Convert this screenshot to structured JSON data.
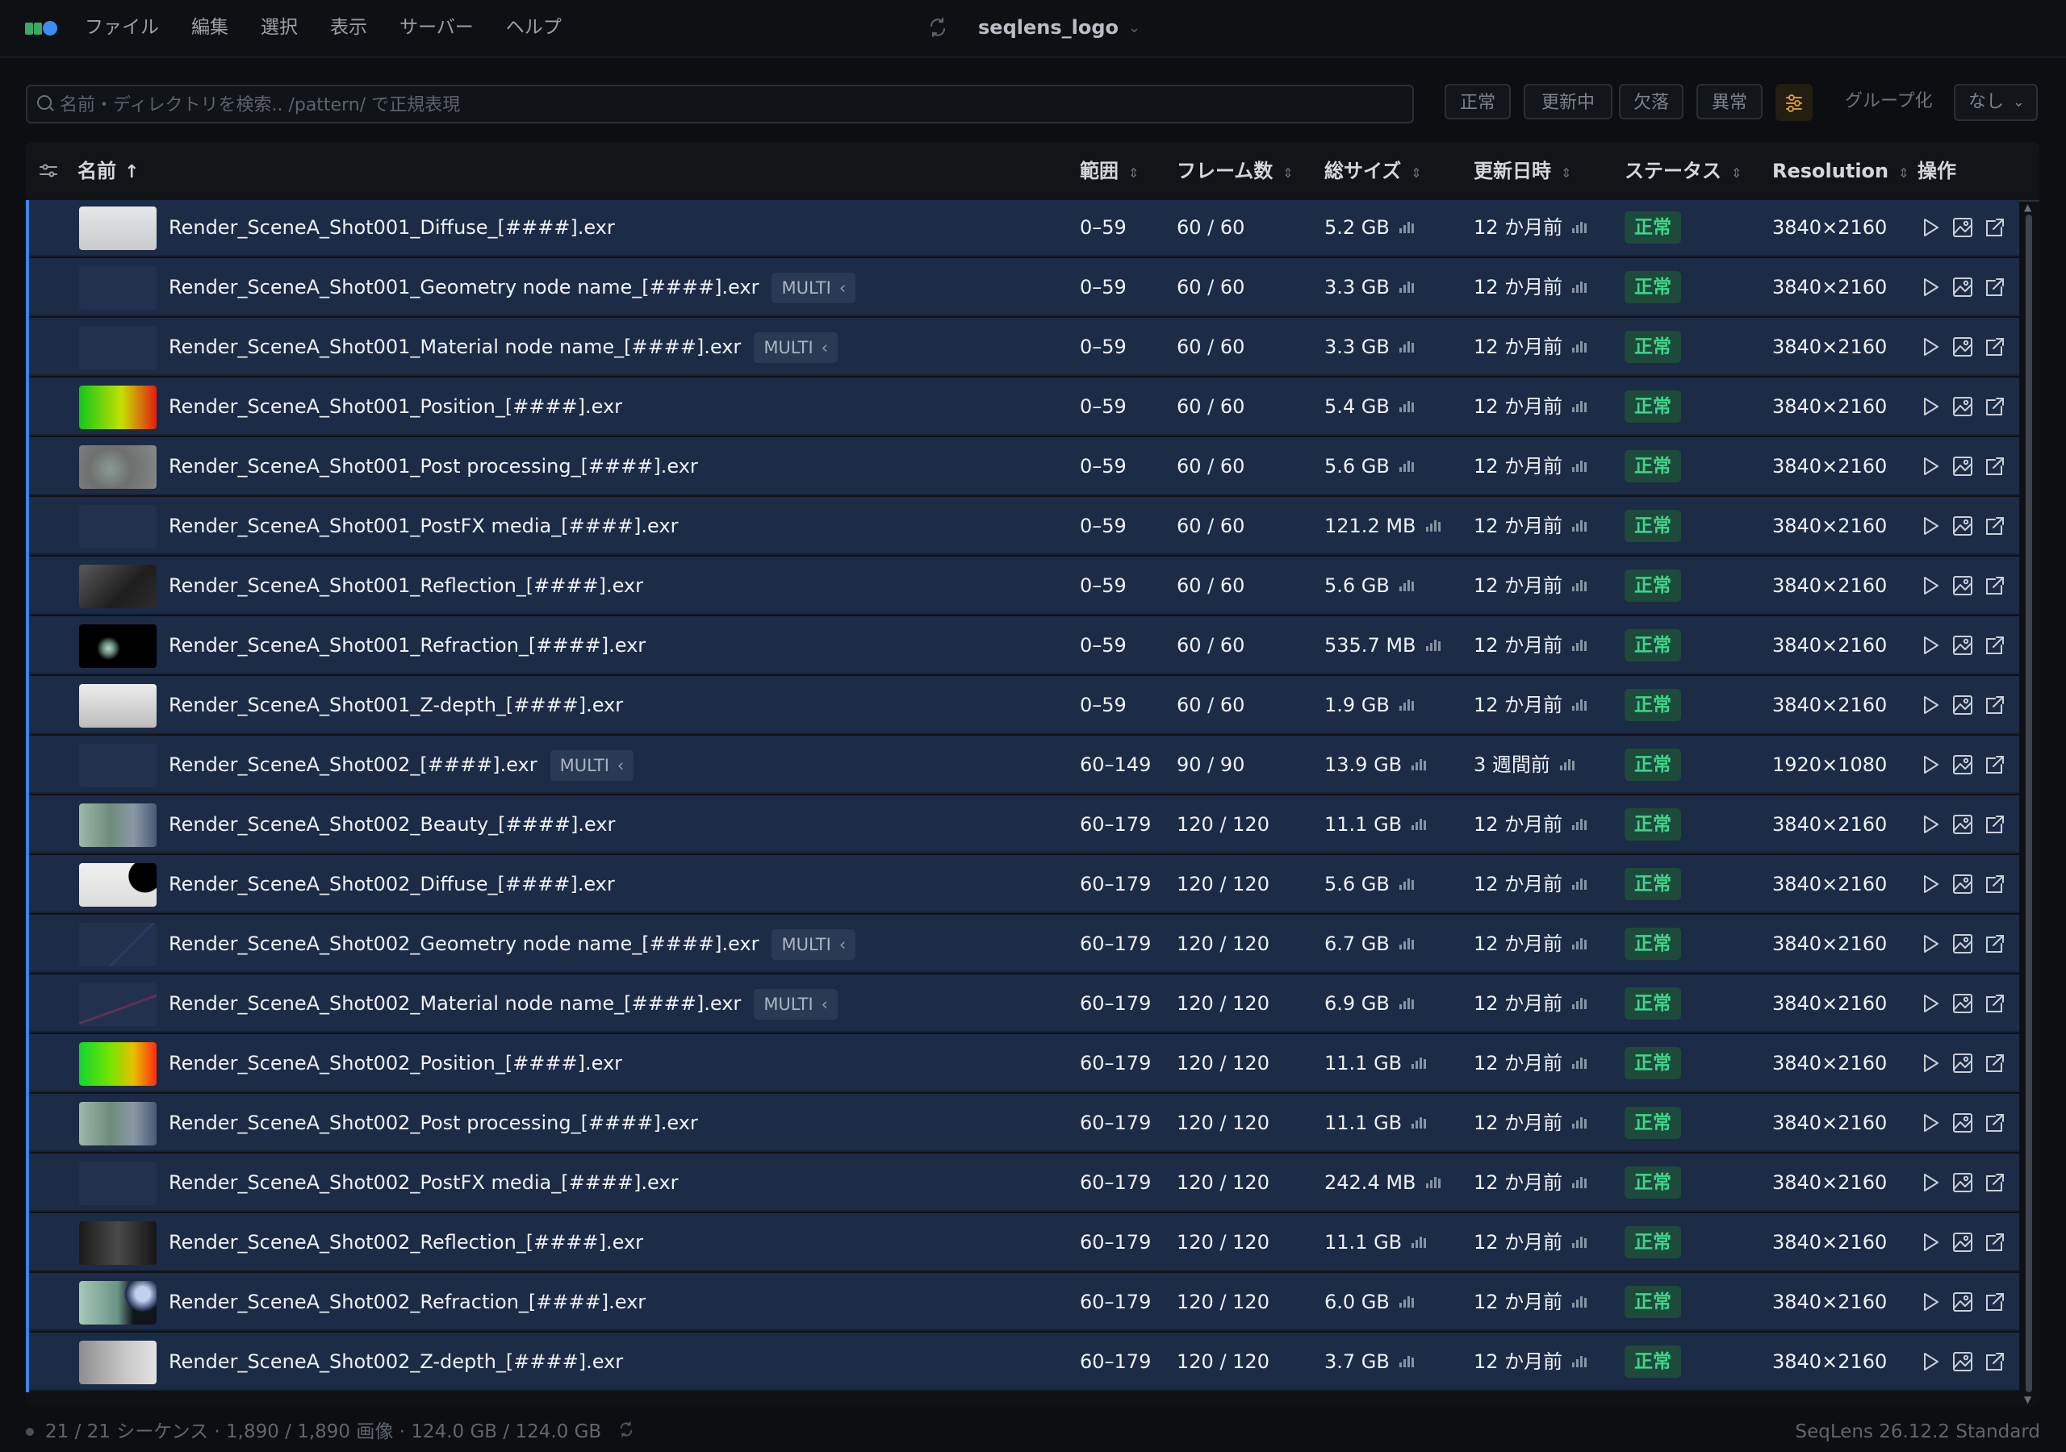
{
  "menu": [
    "ファイル",
    "編集",
    "選択",
    "表示",
    "サーバー",
    "ヘルプ"
  ],
  "window_title": "seqlens_logo",
  "search": {
    "placeholder": "名前・ディレクトリを検索.. /pattern/ で正規表現",
    "value": ""
  },
  "filters": [
    "正常",
    "更新中",
    "欠落",
    "異常"
  ],
  "group_label": "グループ化",
  "group_value": "なし",
  "columns": {
    "name": "名前",
    "range": "範囲",
    "frames": "フレーム数",
    "size": "総サイズ",
    "modified": "更新日時",
    "status": "ステータス",
    "resolution": "Resolution",
    "actions": "操作"
  },
  "rows": [
    {
      "name": "Render_SceneA_Shot001_Diffuse_[####].exr",
      "multi": "",
      "range": "0–59",
      "frames": "60 / 60",
      "size": "5.2 GB",
      "modified": "12 か月前",
      "status": "正常",
      "res": "3840×2160",
      "thumb": "diffuse1"
    },
    {
      "name": "Render_SceneA_Shot001_Geometry node name_[####].exr",
      "multi": "MULTI",
      "range": "0–59",
      "frames": "60 / 60",
      "size": "3.3 GB",
      "modified": "12 か月前",
      "status": "正常",
      "res": "3840×2160",
      "thumb": "blank"
    },
    {
      "name": "Render_SceneA_Shot001_Material node name_[####].exr",
      "multi": "MULTI",
      "range": "0–59",
      "frames": "60 / 60",
      "size": "3.3 GB",
      "modified": "12 か月前",
      "status": "正常",
      "res": "3840×2160",
      "thumb": "material1"
    },
    {
      "name": "Render_SceneA_Shot001_Position_[####].exr",
      "multi": "",
      "range": "0–59",
      "frames": "60 / 60",
      "size": "5.4 GB",
      "modified": "12 か月前",
      "status": "正常",
      "res": "3840×2160",
      "thumb": "position1"
    },
    {
      "name": "Render_SceneA_Shot001_Post processing_[####].exr",
      "multi": "",
      "range": "0–59",
      "frames": "60 / 60",
      "size": "5.6 GB",
      "modified": "12 か月前",
      "status": "正常",
      "res": "3840×2160",
      "thumb": "post1"
    },
    {
      "name": "Render_SceneA_Shot001_PostFX media_[####].exr",
      "multi": "",
      "range": "0–59",
      "frames": "60 / 60",
      "size": "121.2 MB",
      "modified": "12 か月前",
      "status": "正常",
      "res": "3840×2160",
      "thumb": "blank"
    },
    {
      "name": "Render_SceneA_Shot001_Reflection_[####].exr",
      "multi": "",
      "range": "0–59",
      "frames": "60 / 60",
      "size": "5.6 GB",
      "modified": "12 か月前",
      "status": "正常",
      "res": "3840×2160",
      "thumb": "reflect1"
    },
    {
      "name": "Render_SceneA_Shot001_Refraction_[####].exr",
      "multi": "",
      "range": "0–59",
      "frames": "60 / 60",
      "size": "535.7 MB",
      "modified": "12 か月前",
      "status": "正常",
      "res": "3840×2160",
      "thumb": "refract1"
    },
    {
      "name": "Render_SceneA_Shot001_Z-depth_[####].exr",
      "multi": "",
      "range": "0–59",
      "frames": "60 / 60",
      "size": "1.9 GB",
      "modified": "12 か月前",
      "status": "正常",
      "res": "3840×2160",
      "thumb": "zdepth1"
    },
    {
      "name": "Render_SceneA_Shot002_[####].exr",
      "multi": "MULTI",
      "range": "60–149",
      "frames": "90 / 90",
      "size": "13.9 GB",
      "modified": "3 週間前",
      "status": "正常",
      "res": "1920×1080",
      "thumb": "blank"
    },
    {
      "name": "Render_SceneA_Shot002_Beauty_[####].exr",
      "multi": "",
      "range": "60–179",
      "frames": "120 / 120",
      "size": "11.1 GB",
      "modified": "12 か月前",
      "status": "正常",
      "res": "3840×2160",
      "thumb": "beauty2"
    },
    {
      "name": "Render_SceneA_Shot002_Diffuse_[####].exr",
      "multi": "",
      "range": "60–179",
      "frames": "120 / 120",
      "size": "5.6 GB",
      "modified": "12 か月前",
      "status": "正常",
      "res": "3840×2160",
      "thumb": "diffuse2"
    },
    {
      "name": "Render_SceneA_Shot002_Geometry node name_[####].exr",
      "multi": "MULTI",
      "range": "60–179",
      "frames": "120 / 120",
      "size": "6.7 GB",
      "modified": "12 か月前",
      "status": "正常",
      "res": "3840×2160",
      "thumb": "geo2"
    },
    {
      "name": "Render_SceneA_Shot002_Material node name_[####].exr",
      "multi": "MULTI",
      "range": "60–179",
      "frames": "120 / 120",
      "size": "6.9 GB",
      "modified": "12 か月前",
      "status": "正常",
      "res": "3840×2160",
      "thumb": "material2"
    },
    {
      "name": "Render_SceneA_Shot002_Position_[####].exr",
      "multi": "",
      "range": "60–179",
      "frames": "120 / 120",
      "size": "11.1 GB",
      "modified": "12 か月前",
      "status": "正常",
      "res": "3840×2160",
      "thumb": "position2"
    },
    {
      "name": "Render_SceneA_Shot002_Post processing_[####].exr",
      "multi": "",
      "range": "60–179",
      "frames": "120 / 120",
      "size": "11.1 GB",
      "modified": "12 か月前",
      "status": "正常",
      "res": "3840×2160",
      "thumb": "beauty2"
    },
    {
      "name": "Render_SceneA_Shot002_PostFX media_[####].exr",
      "multi": "",
      "range": "60–179",
      "frames": "120 / 120",
      "size": "242.4 MB",
      "modified": "12 か月前",
      "status": "正常",
      "res": "3840×2160",
      "thumb": "blank"
    },
    {
      "name": "Render_SceneA_Shot002_Reflection_[####].exr",
      "multi": "",
      "range": "60–179",
      "frames": "120 / 120",
      "size": "11.1 GB",
      "modified": "12 か月前",
      "status": "正常",
      "res": "3840×2160",
      "thumb": "reflect2"
    },
    {
      "name": "Render_SceneA_Shot002_Refraction_[####].exr",
      "multi": "",
      "range": "60–179",
      "frames": "120 / 120",
      "size": "6.0 GB",
      "modified": "12 か月前",
      "status": "正常",
      "res": "3840×2160",
      "thumb": "refract2"
    },
    {
      "name": "Render_SceneA_Shot002_Z-depth_[####].exr",
      "multi": "",
      "range": "60–179",
      "frames": "120 / 120",
      "size": "3.7 GB",
      "modified": "12 か月前",
      "status": "正常",
      "res": "3840×2160",
      "thumb": "zdepth2"
    }
  ],
  "statusbar": {
    "summary": "21 / 21 シーケンス · 1,890 / 1,890 画像 · 124.0 GB / 124.0 GB",
    "version": "SeqLens 26.12.2 Standard"
  },
  "colors": {
    "row_bg": "#1c2b46",
    "row_accent": "#3b86e8",
    "status_ok_bg": "#1e4a3b",
    "status_ok_text": "#3fd58a"
  },
  "icons": [
    "search-icon",
    "sync-icon",
    "chevron-down-icon",
    "column-settings-icon",
    "sort-asc-icon",
    "sort-icon",
    "size-histogram-icon",
    "play-icon",
    "image-icon",
    "open-external-icon",
    "filter-settings-icon",
    "refresh-icon"
  ]
}
